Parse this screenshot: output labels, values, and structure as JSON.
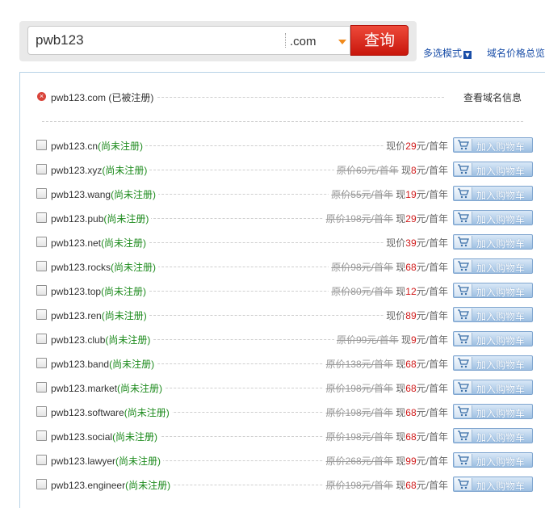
{
  "search": {
    "query": "pwb123",
    "tld": ".com",
    "button_label": "查询"
  },
  "links": {
    "multi_mode": "多选模式",
    "price_overview": "域名价格总览"
  },
  "registered": {
    "name": "pwb123.com",
    "status": "(已被注册)",
    "action": "查看域名信息"
  },
  "cart_label": "加入购物车",
  "available_label": "(尚未注册)",
  "domains": [
    {
      "name": "pwb123.cn",
      "original": "",
      "current": "29"
    },
    {
      "name": "pwb123.xyz",
      "original": "69",
      "current": "8"
    },
    {
      "name": "pwb123.wang",
      "original": "55",
      "current": "19"
    },
    {
      "name": "pwb123.pub",
      "original": "198",
      "current": "29"
    },
    {
      "name": "pwb123.net",
      "original": "",
      "current": "39"
    },
    {
      "name": "pwb123.rocks",
      "original": "98",
      "current": "68"
    },
    {
      "name": "pwb123.top",
      "original": "80",
      "current": "12"
    },
    {
      "name": "pwb123.ren",
      "original": "",
      "current": "89"
    },
    {
      "name": "pwb123.club",
      "original": "99",
      "current": "9"
    },
    {
      "name": "pwb123.band",
      "original": "138",
      "current": "68"
    },
    {
      "name": "pwb123.market",
      "original": "198",
      "current": "68"
    },
    {
      "name": "pwb123.software",
      "original": "198",
      "current": "68"
    },
    {
      "name": "pwb123.social",
      "original": "198",
      "current": "68"
    },
    {
      "name": "pwb123.lawyer",
      "original": "268",
      "current": "99"
    },
    {
      "name": "pwb123.engineer",
      "original": "198",
      "current": "68"
    }
  ],
  "price_text": {
    "original_prefix": "原价",
    "current_prefix_with_orig": "现",
    "current_prefix": "现价",
    "unit": "元/首年"
  }
}
